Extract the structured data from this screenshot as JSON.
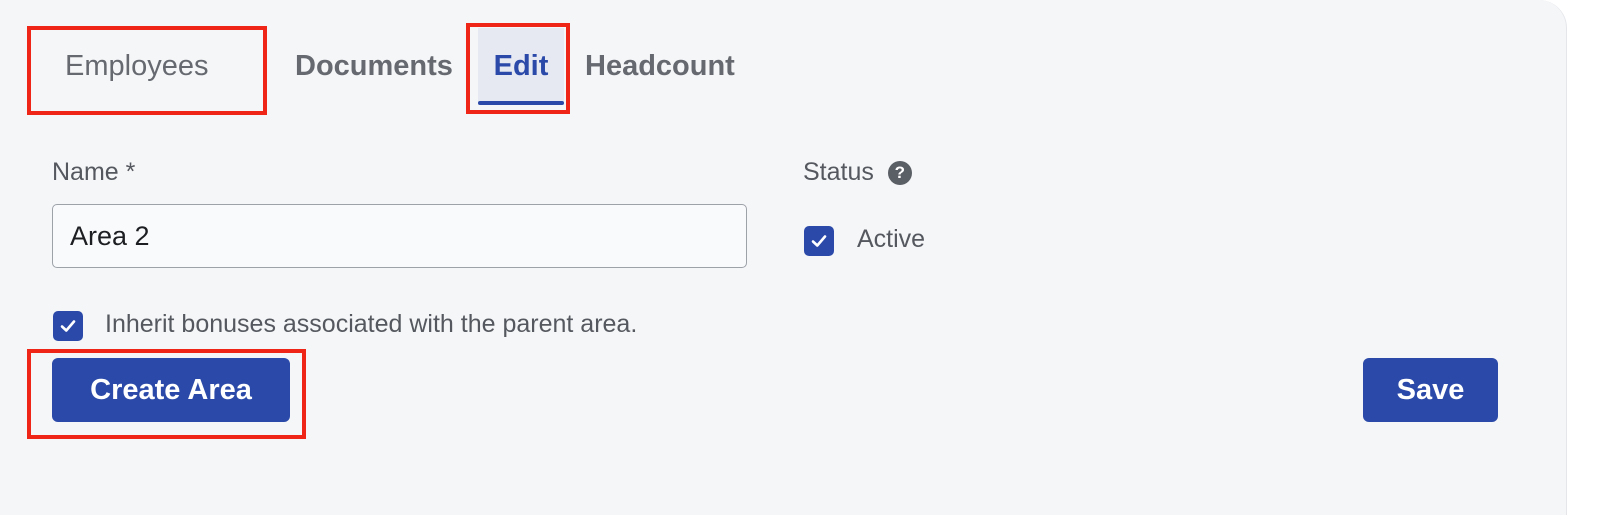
{
  "tabs": {
    "employees": "Employees",
    "documents": "Documents",
    "edit": "Edit",
    "headcount": "Headcount"
  },
  "active_tab": "Edit",
  "form": {
    "name_label": "Name *",
    "name_value": "Area 2",
    "status_label": "Status",
    "status_help_icon": "question-circle-icon",
    "status_active_checked": true,
    "status_active_label": "Active",
    "inherit_checked": true,
    "inherit_label": "Inherit bonuses associated with the parent area."
  },
  "buttons": {
    "create_area": "Create Area",
    "save": "Save"
  },
  "colors": {
    "accent": "#2b49a8",
    "highlight": "#ee2517",
    "panel_bg": "#f5f6f8"
  }
}
